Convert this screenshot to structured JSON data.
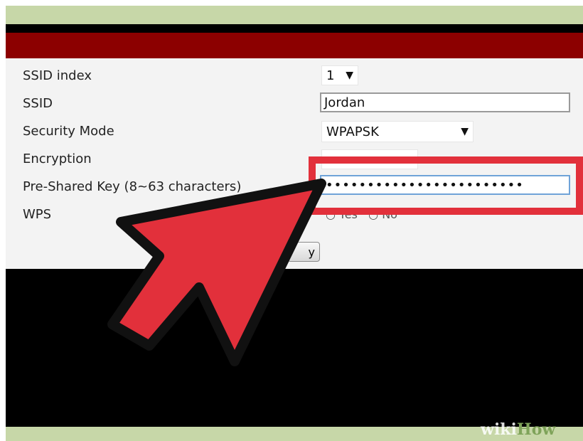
{
  "form": {
    "labels": {
      "ssid_index": "SSID index",
      "ssid": "SSID",
      "security_mode": "Security Mode",
      "encryption": "Encryption",
      "psk": "Pre-Shared Key (8~63 characters)",
      "wps": "WPS"
    },
    "values": {
      "ssid_index": "1",
      "ssid": "Jordan",
      "security_mode": "WPAPSK",
      "psk_masked": "••••••••••••••••••••••••",
      "wps_yes": "Yes",
      "wps_no": "No"
    },
    "apply_label": "y",
    "arrow_glyph": "▼"
  },
  "watermark": {
    "part1": "wiki",
    "part2": "How"
  },
  "colors": {
    "accent_red": "#e2303b",
    "band_red": "#8c0000",
    "frame_green": "#c7d7a8"
  }
}
